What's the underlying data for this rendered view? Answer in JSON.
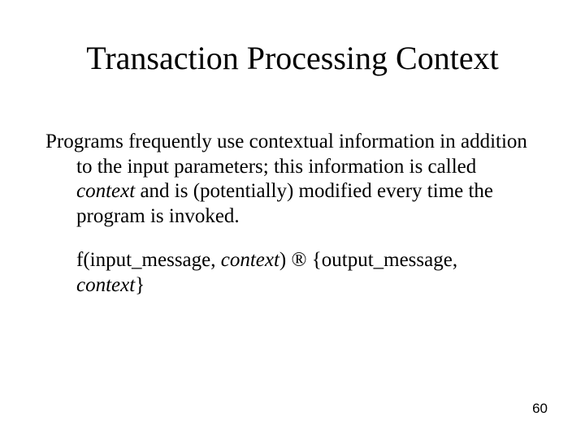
{
  "title": "Transaction Processing Context",
  "body": {
    "p1_a": "Programs frequently use contextual information in addition to the input parameters; this information is called ",
    "p1_b": "context",
    "p1_c": " and is (potentially) modified every time the program is invoked.",
    "formula_a": "f(input_message, ",
    "formula_b": "context",
    "formula_c": ") ",
    "formula_arrow": "®",
    "formula_d": " {output_message, ",
    "formula_e": "context",
    "formula_f": "}"
  },
  "page_number": "60"
}
